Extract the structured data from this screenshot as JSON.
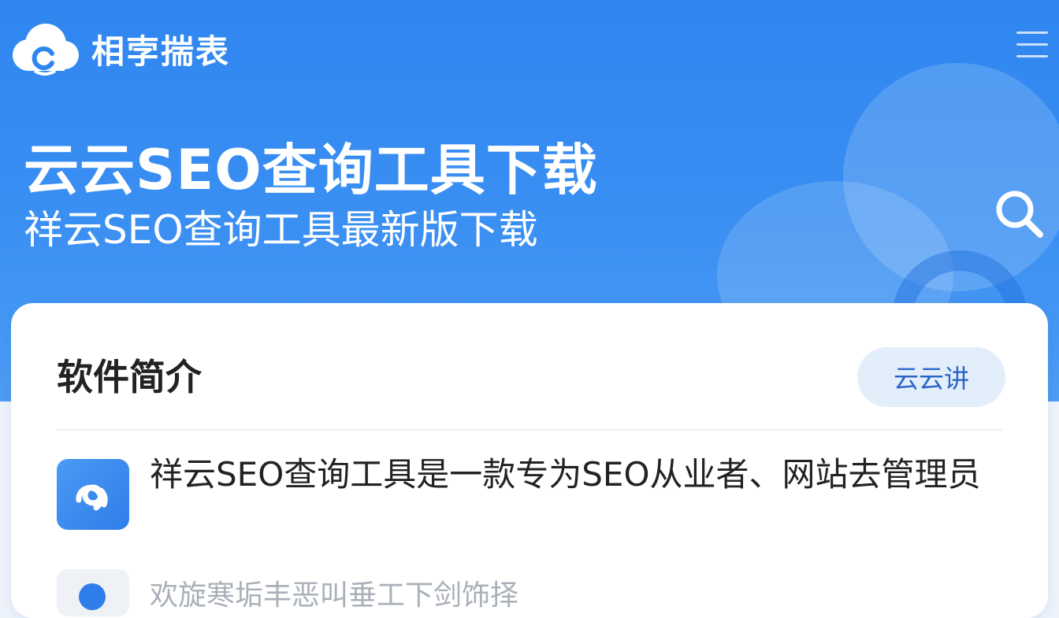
{
  "header": {
    "brand": "相孛揣表",
    "logo_icon": "cloud-logo-icon",
    "menu_icon": "hamburger-menu-icon"
  },
  "hero": {
    "title": "云云SEO查询工具下载",
    "subtitle": "祥云SEO查询工具最新版下载",
    "search_icon": "search-icon"
  },
  "card": {
    "title": "软件简介",
    "tag_button": "云云讲",
    "description": "祥云SEO查询工具是一款专为SEO从业者、网站去管理员",
    "second_item": "欢旋寒垢丰恶叫垂工下剑饰择"
  },
  "colors": {
    "brand_blue": "#2f86f0",
    "tag_text": "#2b66c8",
    "tag_bg": "#e3eefb"
  }
}
